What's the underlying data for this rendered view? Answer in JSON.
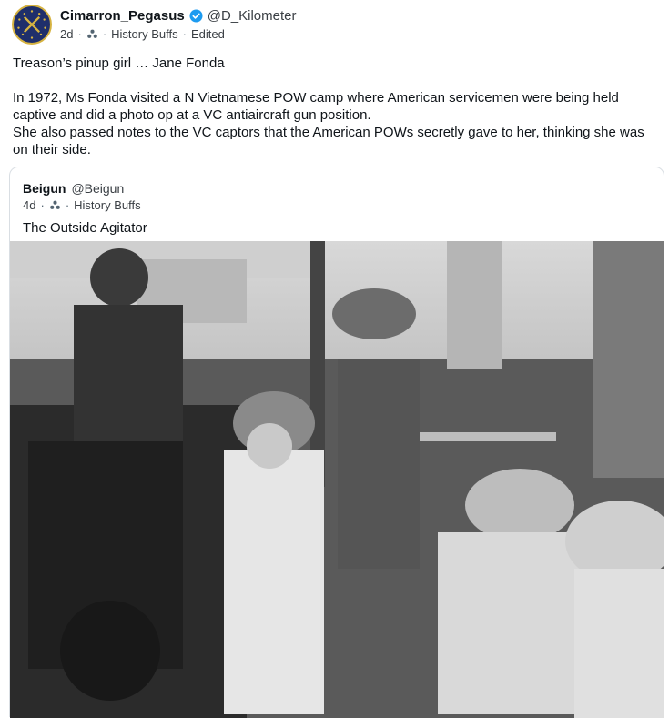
{
  "post": {
    "author": {
      "display_name": "Cimarron_Pegasus",
      "handle": "@D_Kilometer",
      "verified": true,
      "avatar_icon": "crossed-rifles-emblem-icon"
    },
    "meta": {
      "age": "2d",
      "community": "History Buffs",
      "edited": "Edited"
    },
    "text": {
      "line1": "Treason’s pinup girl … Jane Fonda",
      "line2": "In 1972, Ms Fonda visited a N Vietnamese POW camp where American servicemen were being held captive and did a photo op at a VC antiaircraft gun position.",
      "line3": "She also passed notes to the VC captors that the American POWs secretly gave to her, thinking she was on their side."
    }
  },
  "quote": {
    "author": {
      "display_name": "Beigun",
      "handle": "@Beigun"
    },
    "meta": {
      "age": "4d",
      "community": "History Buffs"
    },
    "text": "The Outside Agitator",
    "image_icon": "black-and-white-photo"
  },
  "colors": {
    "verified_blue": "#1d9bf0",
    "border": "#d9dee3",
    "secondary_text": "#3a3f44"
  }
}
